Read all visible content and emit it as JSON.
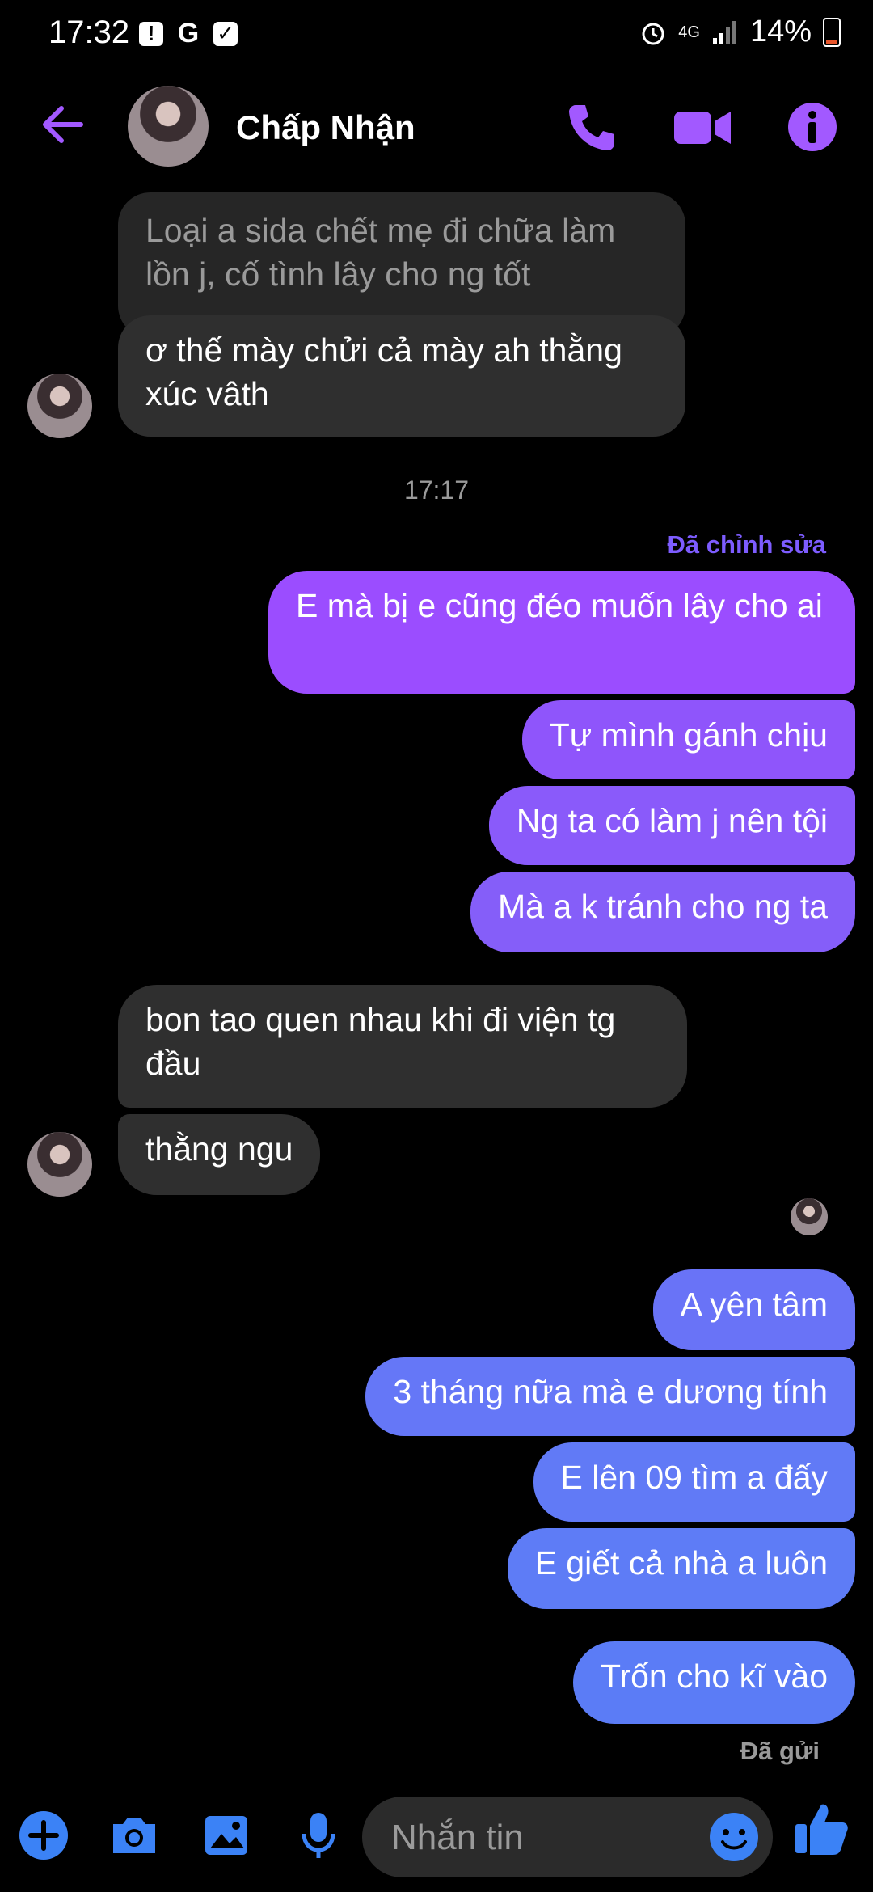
{
  "status_bar": {
    "time": "17:32",
    "network": "4G",
    "battery": "14%"
  },
  "header": {
    "contact_name": "Chấp Nhận"
  },
  "messages": {
    "quoted": "Loại a sida chết mẹ đi chữa làm lồn j, cố tình lây cho ng tốt",
    "m1": "ơ thế mày chửi cả mày ah thằng xúc vâth",
    "timestamp": "17:17",
    "edited_label": "Đã chỉnh sửa",
    "m2": "E mà bị e cũng đéo muốn lây cho ai",
    "m3": "Tự mình gánh chịu",
    "m4": "Ng ta có làm j nên tội",
    "m5": "Mà a k tránh cho ng ta",
    "m6": "bon tao quen nhau khi đi viện tg đầu",
    "m7": "thằng ngu",
    "m8": "A yên tâm",
    "m9": "3 tháng nữa mà e dương tính",
    "m10": "E lên 09 tìm a đấy",
    "m11": "E giết cả nhà a luôn",
    "m12": "Trốn cho kĩ vào",
    "sent_label": "Đã gửi"
  },
  "composer": {
    "placeholder": "Nhắn tin"
  },
  "colors": {
    "accent": "#a259ff",
    "purple_top": "#9b4dff",
    "blue_bottom": "#5b7cf6",
    "incoming": "#2f2f2f"
  }
}
